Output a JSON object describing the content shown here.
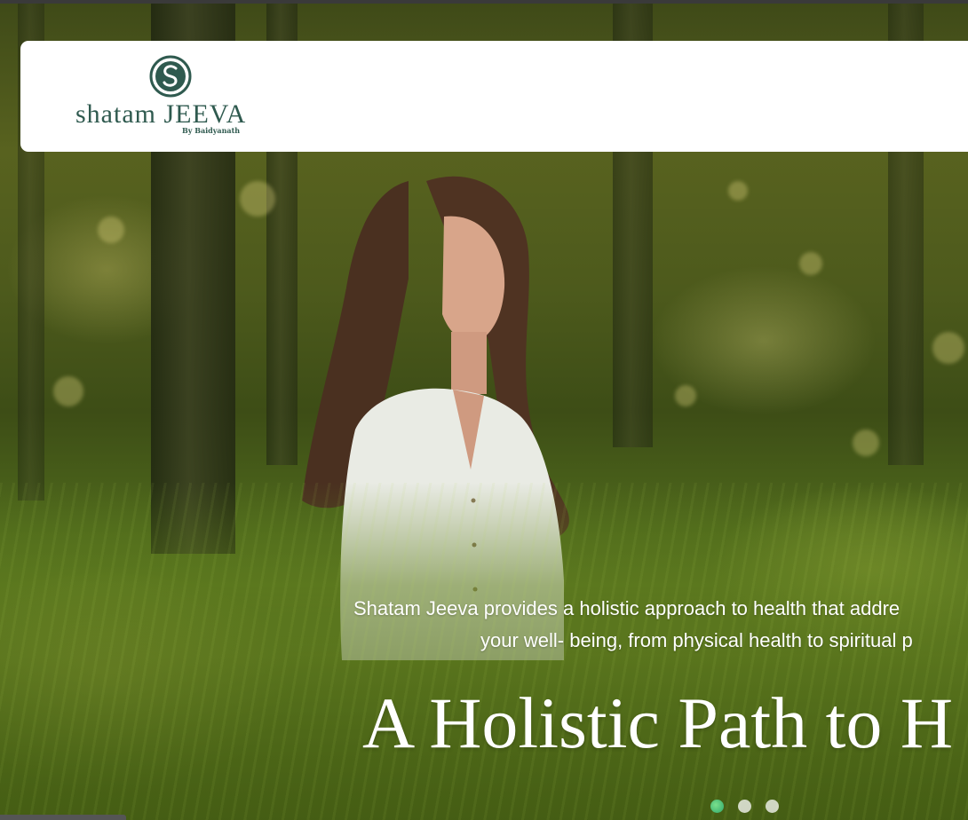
{
  "brand": {
    "name": "Shatam Jeeva",
    "logo_wordmark": "shatam JEEVA",
    "logo_sub": "By Baidyanath",
    "color": "#2f5a4f"
  },
  "hero": {
    "lead_line1": "Shatam Jeeva provides a holistic approach to health that addre",
    "lead_line2": "your well- being, from physical health to spiritual p",
    "headline": "A Holistic Path to H",
    "background": "forest-meditation-image"
  },
  "carousel": {
    "slides": 3,
    "active_index": 0,
    "active_color": "#3fbf7a"
  }
}
